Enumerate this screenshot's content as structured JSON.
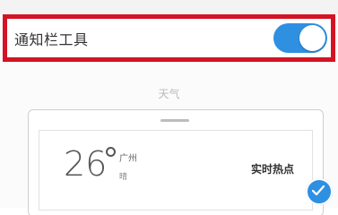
{
  "setting": {
    "label": "通知栏工具",
    "toggle_on": true
  },
  "section_caption": "天气",
  "widget": {
    "temperature": "26",
    "city": "广州",
    "weather": "晴",
    "hot_news": "实时热点"
  },
  "colors": {
    "toggle_accent": "#2f90e2",
    "highlight_border": "#d21424"
  },
  "icons": {
    "selected": "check-icon"
  }
}
